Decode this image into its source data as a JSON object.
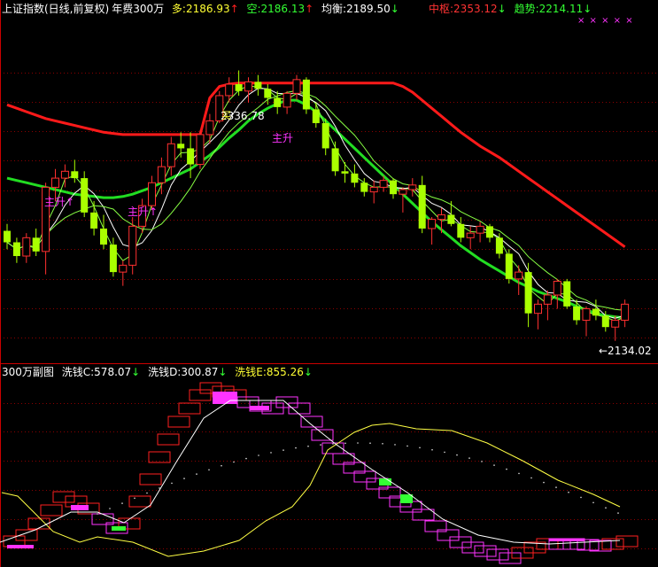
{
  "header_main": {
    "title": "上证指数(日线,前复权)",
    "indicator": "年费300万",
    "duo_label": "多:",
    "duo_value": "2186.93",
    "duo_arrow": "↑",
    "kong_label": "空:",
    "kong_value": "2186.13",
    "kong_arrow": "↑",
    "junheng_label": "均衡:",
    "junheng_value": "2189.50",
    "junheng_arrow": "↓",
    "zhongshu_label": "中枢:",
    "zhongshu_value": "2353.12",
    "zhongshu_arrow": "↓",
    "qushi_label": "趋势:",
    "qushi_value": "2214.11",
    "qushi_arrow": "↓",
    "crosses": "× × × × ×"
  },
  "header_sub": {
    "title": "300万副图",
    "c_label": "洗钱C:",
    "c_value": "578.07",
    "c_arrow": "↓",
    "d_label": "洗钱D:",
    "d_value": "300.87",
    "d_arrow": "↓",
    "e_label": "洗钱E:",
    "e_value": "855.26",
    "e_arrow": "↓"
  },
  "annotations": {
    "zhusheng_1": "主升↑",
    "zhusheng_2": "主升↑",
    "zhusheng_3": "主升",
    "peak_value": "2336.78",
    "low_value": "←2134.02",
    "buy_mark": "买"
  },
  "colors": {
    "background": "#000000",
    "grid": "#8b0000",
    "up_candle": "#ff3030",
    "down_candle": "#aaff00",
    "zhongshu_line": "#ff1a1a",
    "trend_line": "#22dd22",
    "short_line_white": "#ffffff",
    "short_line_green": "#88ff44",
    "box_up": "#ff2020",
    "box_down": "#ff33ff",
    "box_fill_up": "#ff33ff",
    "box_fill_down": "#33ff33",
    "yellow_line": "#ffff44"
  },
  "chart_data": [
    {
      "type": "candlestick",
      "title": "上证指数(日线,前复权)",
      "ylim": [
        2110,
        2410
      ],
      "candles": [
        [
          2224,
          2230,
          2208,
          2214
        ],
        [
          2214,
          2218,
          2196,
          2202
        ],
        [
          2202,
          2222,
          2196,
          2218
        ],
        [
          2218,
          2226,
          2202,
          2206
        ],
        [
          2206,
          2266,
          2186,
          2262
        ],
        [
          2262,
          2278,
          2250,
          2270
        ],
        [
          2270,
          2282,
          2262,
          2276
        ],
        [
          2276,
          2286,
          2266,
          2270
        ],
        [
          2270,
          2276,
          2236,
          2240
        ],
        [
          2240,
          2250,
          2220,
          2226
        ],
        [
          2226,
          2238,
          2208,
          2212
        ],
        [
          2212,
          2218,
          2184,
          2188
        ],
        [
          2188,
          2198,
          2176,
          2194
        ],
        [
          2194,
          2236,
          2186,
          2228
        ],
        [
          2228,
          2252,
          2222,
          2246
        ],
        [
          2246,
          2272,
          2242,
          2266
        ],
        [
          2266,
          2288,
          2256,
          2280
        ],
        [
          2280,
          2306,
          2272,
          2300
        ],
        [
          2300,
          2310,
          2288,
          2296
        ],
        [
          2296,
          2310,
          2270,
          2282
        ],
        [
          2282,
          2312,
          2278,
          2308
        ],
        [
          2308,
          2326,
          2300,
          2320
        ],
        [
          2320,
          2346,
          2318,
          2342
        ],
        [
          2342,
          2358,
          2336,
          2352
        ],
        [
          2352,
          2364,
          2342,
          2346
        ],
        [
          2346,
          2358,
          2336,
          2354
        ],
        [
          2354,
          2360,
          2342,
          2348
        ],
        [
          2348,
          2352,
          2334,
          2340
        ],
        [
          2340,
          2346,
          2326,
          2332
        ],
        [
          2332,
          2346,
          2326,
          2344
        ],
        [
          2344,
          2360,
          2338,
          2356
        ],
        [
          2356,
          2358,
          2326,
          2330
        ],
        [
          2330,
          2336,
          2314,
          2318
        ],
        [
          2318,
          2322,
          2290,
          2296
        ],
        [
          2296,
          2302,
          2272,
          2276
        ],
        [
          2276,
          2284,
          2266,
          2274
        ],
        [
          2274,
          2282,
          2262,
          2266
        ],
        [
          2266,
          2270,
          2254,
          2258
        ],
        [
          2258,
          2268,
          2248,
          2262
        ],
        [
          2262,
          2272,
          2258,
          2268
        ],
        [
          2268,
          2270,
          2252,
          2256
        ],
        [
          2256,
          2262,
          2240,
          2260
        ],
        [
          2260,
          2270,
          2254,
          2264
        ],
        [
          2264,
          2272,
          2222,
          2226
        ],
        [
          2226,
          2236,
          2212,
          2234
        ],
        [
          2234,
          2244,
          2222,
          2238
        ],
        [
          2238,
          2250,
          2228,
          2230
        ],
        [
          2230,
          2236,
          2214,
          2218
        ],
        [
          2218,
          2228,
          2208,
          2222
        ],
        [
          2222,
          2232,
          2214,
          2228
        ],
        [
          2228,
          2230,
          2214,
          2218
        ],
        [
          2218,
          2222,
          2200,
          2204
        ],
        [
          2204,
          2208,
          2178,
          2182
        ],
        [
          2182,
          2194,
          2168,
          2188
        ],
        [
          2188,
          2196,
          2140,
          2152
        ],
        [
          2152,
          2164,
          2138,
          2160
        ],
        [
          2160,
          2172,
          2146,
          2168
        ],
        [
          2168,
          2182,
          2156,
          2180
        ],
        [
          2180,
          2182,
          2156,
          2158
        ],
        [
          2158,
          2164,
          2142,
          2146
        ],
        [
          2146,
          2158,
          2132,
          2156
        ],
        [
          2156,
          2164,
          2146,
          2150
        ],
        [
          2150,
          2154,
          2136,
          2140
        ],
        [
          2140,
          2150,
          2128,
          2146
        ],
        [
          2146,
          2164,
          2140,
          2160
        ]
      ],
      "series": [
        {
          "name": "中枢",
          "values": [
            2334,
            2331,
            2328,
            2325,
            2322,
            2320,
            2318,
            2316,
            2314,
            2312,
            2310,
            2309,
            2308,
            2308,
            2308,
            2308,
            2308,
            2308,
            2308,
            2308,
            2308,
            2340,
            2350,
            2352,
            2353,
            2353,
            2353,
            2353,
            2353,
            2353,
            2353,
            2353,
            2353,
            2353,
            2353,
            2353,
            2353,
            2353,
            2353,
            2353,
            2353,
            2350,
            2345,
            2338,
            2331,
            2324,
            2317,
            2310,
            2304,
            2298,
            2293,
            2288,
            2282,
            2276,
            2270,
            2264,
            2258,
            2252,
            2246,
            2240,
            2234,
            2228,
            2222,
            2216,
            2210
          ]
        },
        {
          "name": "趋势",
          "values": [
            2270,
            2268,
            2266,
            2264,
            2262,
            2260,
            2258,
            2256,
            2255,
            2254,
            2253,
            2253,
            2254,
            2256,
            2259,
            2262,
            2266,
            2270,
            2274,
            2278,
            2284,
            2290,
            2297,
            2305,
            2312,
            2320,
            2326,
            2331,
            2335,
            2338,
            2338,
            2334,
            2328,
            2320,
            2312,
            2304,
            2296,
            2288,
            2280,
            2272,
            2264,
            2256,
            2248,
            2240,
            2232,
            2225,
            2218,
            2211,
            2205,
            2199,
            2194,
            2189,
            2184,
            2179,
            2175,
            2171,
            2168,
            2165,
            2162,
            2158,
            2155,
            2152,
            2150,
            2149,
            2148
          ]
        }
      ]
    },
    {
      "type": "box",
      "title": "300万副图",
      "series": [
        {
          "name": "洗钱C",
          "last": 578.07
        },
        {
          "name": "洗钱D",
          "last": 300.87
        },
        {
          "name": "洗钱E",
          "last": 855.26
        }
      ]
    }
  ]
}
